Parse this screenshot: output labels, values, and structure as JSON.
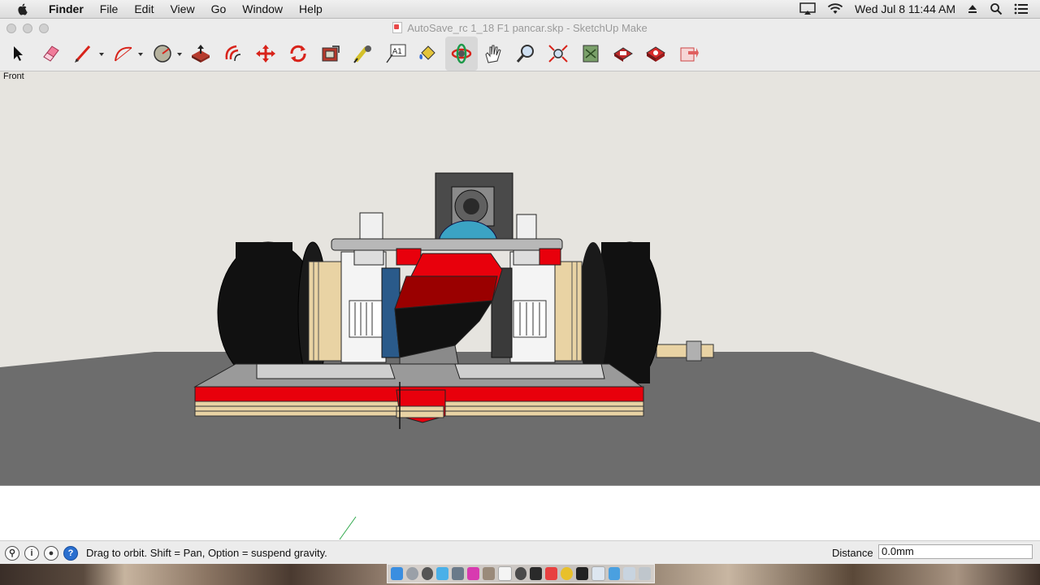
{
  "menubar": {
    "app_name": "Finder",
    "menus": [
      "File",
      "Edit",
      "View",
      "Go",
      "Window",
      "Help"
    ],
    "clock": "Wed Jul 8  11:44 AM"
  },
  "window": {
    "title": "AutoSave_rc 1_18 F1 pancar.skp - SketchUp Make"
  },
  "toolbar": {
    "tools": [
      {
        "icon": "select-arrow-icon"
      },
      {
        "icon": "eraser-icon"
      },
      {
        "icon": "pencil-line-icon",
        "dropdown": true
      },
      {
        "icon": "arc-icon",
        "dropdown": true
      },
      {
        "icon": "circle-shape-icon",
        "dropdown": true
      },
      {
        "icon": "push-pull-icon"
      },
      {
        "icon": "offset-icon"
      },
      {
        "icon": "move-icon"
      },
      {
        "icon": "rotate-icon"
      },
      {
        "icon": "scale-icon"
      },
      {
        "icon": "tape-measure-icon"
      },
      {
        "icon": "text-icon"
      },
      {
        "icon": "paint-bucket-icon"
      },
      {
        "icon": "orbit-icon",
        "active": true
      },
      {
        "icon": "pan-hand-icon"
      },
      {
        "icon": "zoom-icon"
      },
      {
        "icon": "zoom-extents-icon"
      },
      {
        "icon": "3d-warehouse-icon"
      },
      {
        "icon": "extension-warehouse-icon"
      },
      {
        "icon": "layout-icon"
      },
      {
        "icon": "send-to-layout-icon"
      }
    ]
  },
  "viewport": {
    "scene_label": "Front"
  },
  "statusbar": {
    "hint": "Drag to orbit. Shift = Pan, Option = suspend gravity.",
    "distance_label": "Distance",
    "distance_value": "0.0mm"
  },
  "colors": {
    "body_red": "#e8000c",
    "dark_red": "#9a0000",
    "ground_gray": "#6d6d6d",
    "sky": "#e6e4df",
    "wood": "#e9d3a4"
  }
}
